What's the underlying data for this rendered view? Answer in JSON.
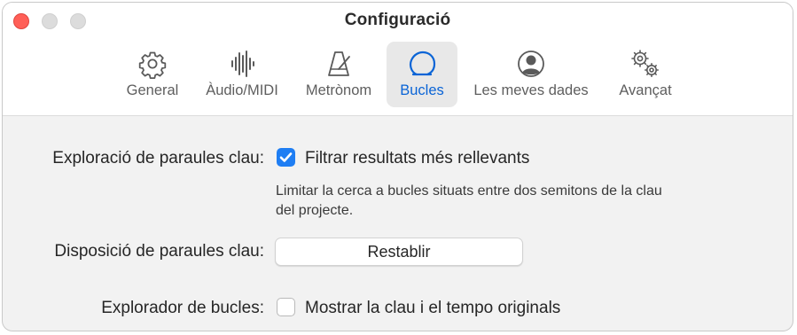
{
  "window": {
    "title": "Configuració"
  },
  "toolbar": {
    "tabs": [
      {
        "label": "General",
        "icon": "gear-icon",
        "selected": false
      },
      {
        "label": "Àudio/MIDI",
        "icon": "waveform-icon",
        "selected": false
      },
      {
        "label": "Metrònom",
        "icon": "metronome-icon",
        "selected": false
      },
      {
        "label": "Bucles",
        "icon": "loop-icon",
        "selected": true
      },
      {
        "label": "Les meves dades",
        "icon": "person-circle-icon",
        "selected": false
      },
      {
        "label": "Avançat",
        "icon": "gears-icon",
        "selected": false
      }
    ]
  },
  "settings": {
    "keyword_browsing": {
      "label": "Exploració de paraules clau:",
      "checkbox_label": "Filtrar resultats més rellevants",
      "checked": true,
      "helper_line1": "Limitar la cerca a bucles situats entre dos semitons de la clau",
      "helper_line2": "del projecte."
    },
    "keyword_layout": {
      "label": "Disposició de paraules clau:",
      "button_label": "Restablir"
    },
    "loop_browser": {
      "label": "Explorador de bucles:",
      "checkbox_label": "Mostrar la clau i el tempo originals",
      "checked": false
    }
  },
  "colors": {
    "accent": "#0a64d6",
    "checkbox_on": "#1f7ef3",
    "close": "#ff5f57"
  }
}
